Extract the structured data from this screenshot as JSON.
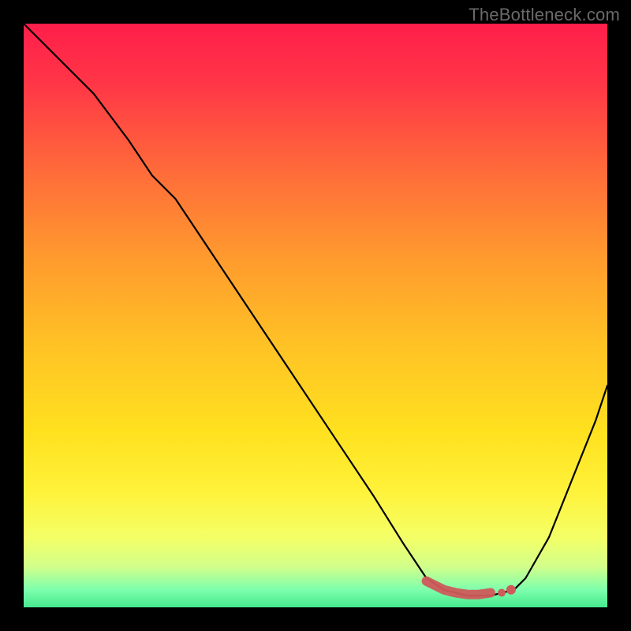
{
  "watermark": "TheBottleneck.com",
  "colors": {
    "curve": "#000000",
    "marker": "#cf5a5a",
    "frame": "#000000"
  },
  "gradient_stops": [
    {
      "offset": 0.0,
      "color": "#ff1e4b"
    },
    {
      "offset": 0.1,
      "color": "#ff3547"
    },
    {
      "offset": 0.25,
      "color": "#ff6a3a"
    },
    {
      "offset": 0.4,
      "color": "#ff9a2e"
    },
    {
      "offset": 0.55,
      "color": "#ffc225"
    },
    {
      "offset": 0.7,
      "color": "#ffe11f"
    },
    {
      "offset": 0.8,
      "color": "#fff23a"
    },
    {
      "offset": 0.88,
      "color": "#f4ff66"
    },
    {
      "offset": 0.93,
      "color": "#d2ff8a"
    },
    {
      "offset": 0.97,
      "color": "#7dffad"
    },
    {
      "offset": 1.0,
      "color": "#46e98e"
    }
  ],
  "chart_data": {
    "type": "line",
    "title": "",
    "xlabel": "",
    "ylabel": "",
    "xlim": [
      0,
      100
    ],
    "ylim": [
      0,
      100
    ],
    "series": [
      {
        "name": "bottleneck-curve",
        "x": [
          0,
          6,
          12,
          18,
          22,
          26,
          30,
          36,
          42,
          48,
          54,
          60,
          65,
          69,
          72,
          74,
          76,
          78,
          80,
          82,
          84,
          86,
          90,
          94,
          98,
          100
        ],
        "y": [
          100,
          94,
          88,
          80,
          74,
          70,
          64,
          55,
          46,
          37,
          28,
          19,
          11,
          5,
          3,
          2.5,
          2,
          2,
          2,
          2.5,
          3,
          5,
          12,
          22,
          32,
          38
        ]
      }
    ],
    "markers": [
      {
        "name": "optimal-range-segment",
        "type": "thick-line",
        "x": [
          69,
          72,
          74,
          76,
          78,
          80
        ],
        "y": [
          4.5,
          3,
          2.5,
          2.2,
          2.2,
          2.5
        ]
      },
      {
        "name": "optimal-point-dot",
        "type": "dot",
        "x": 83.5,
        "y": 3
      }
    ]
  }
}
